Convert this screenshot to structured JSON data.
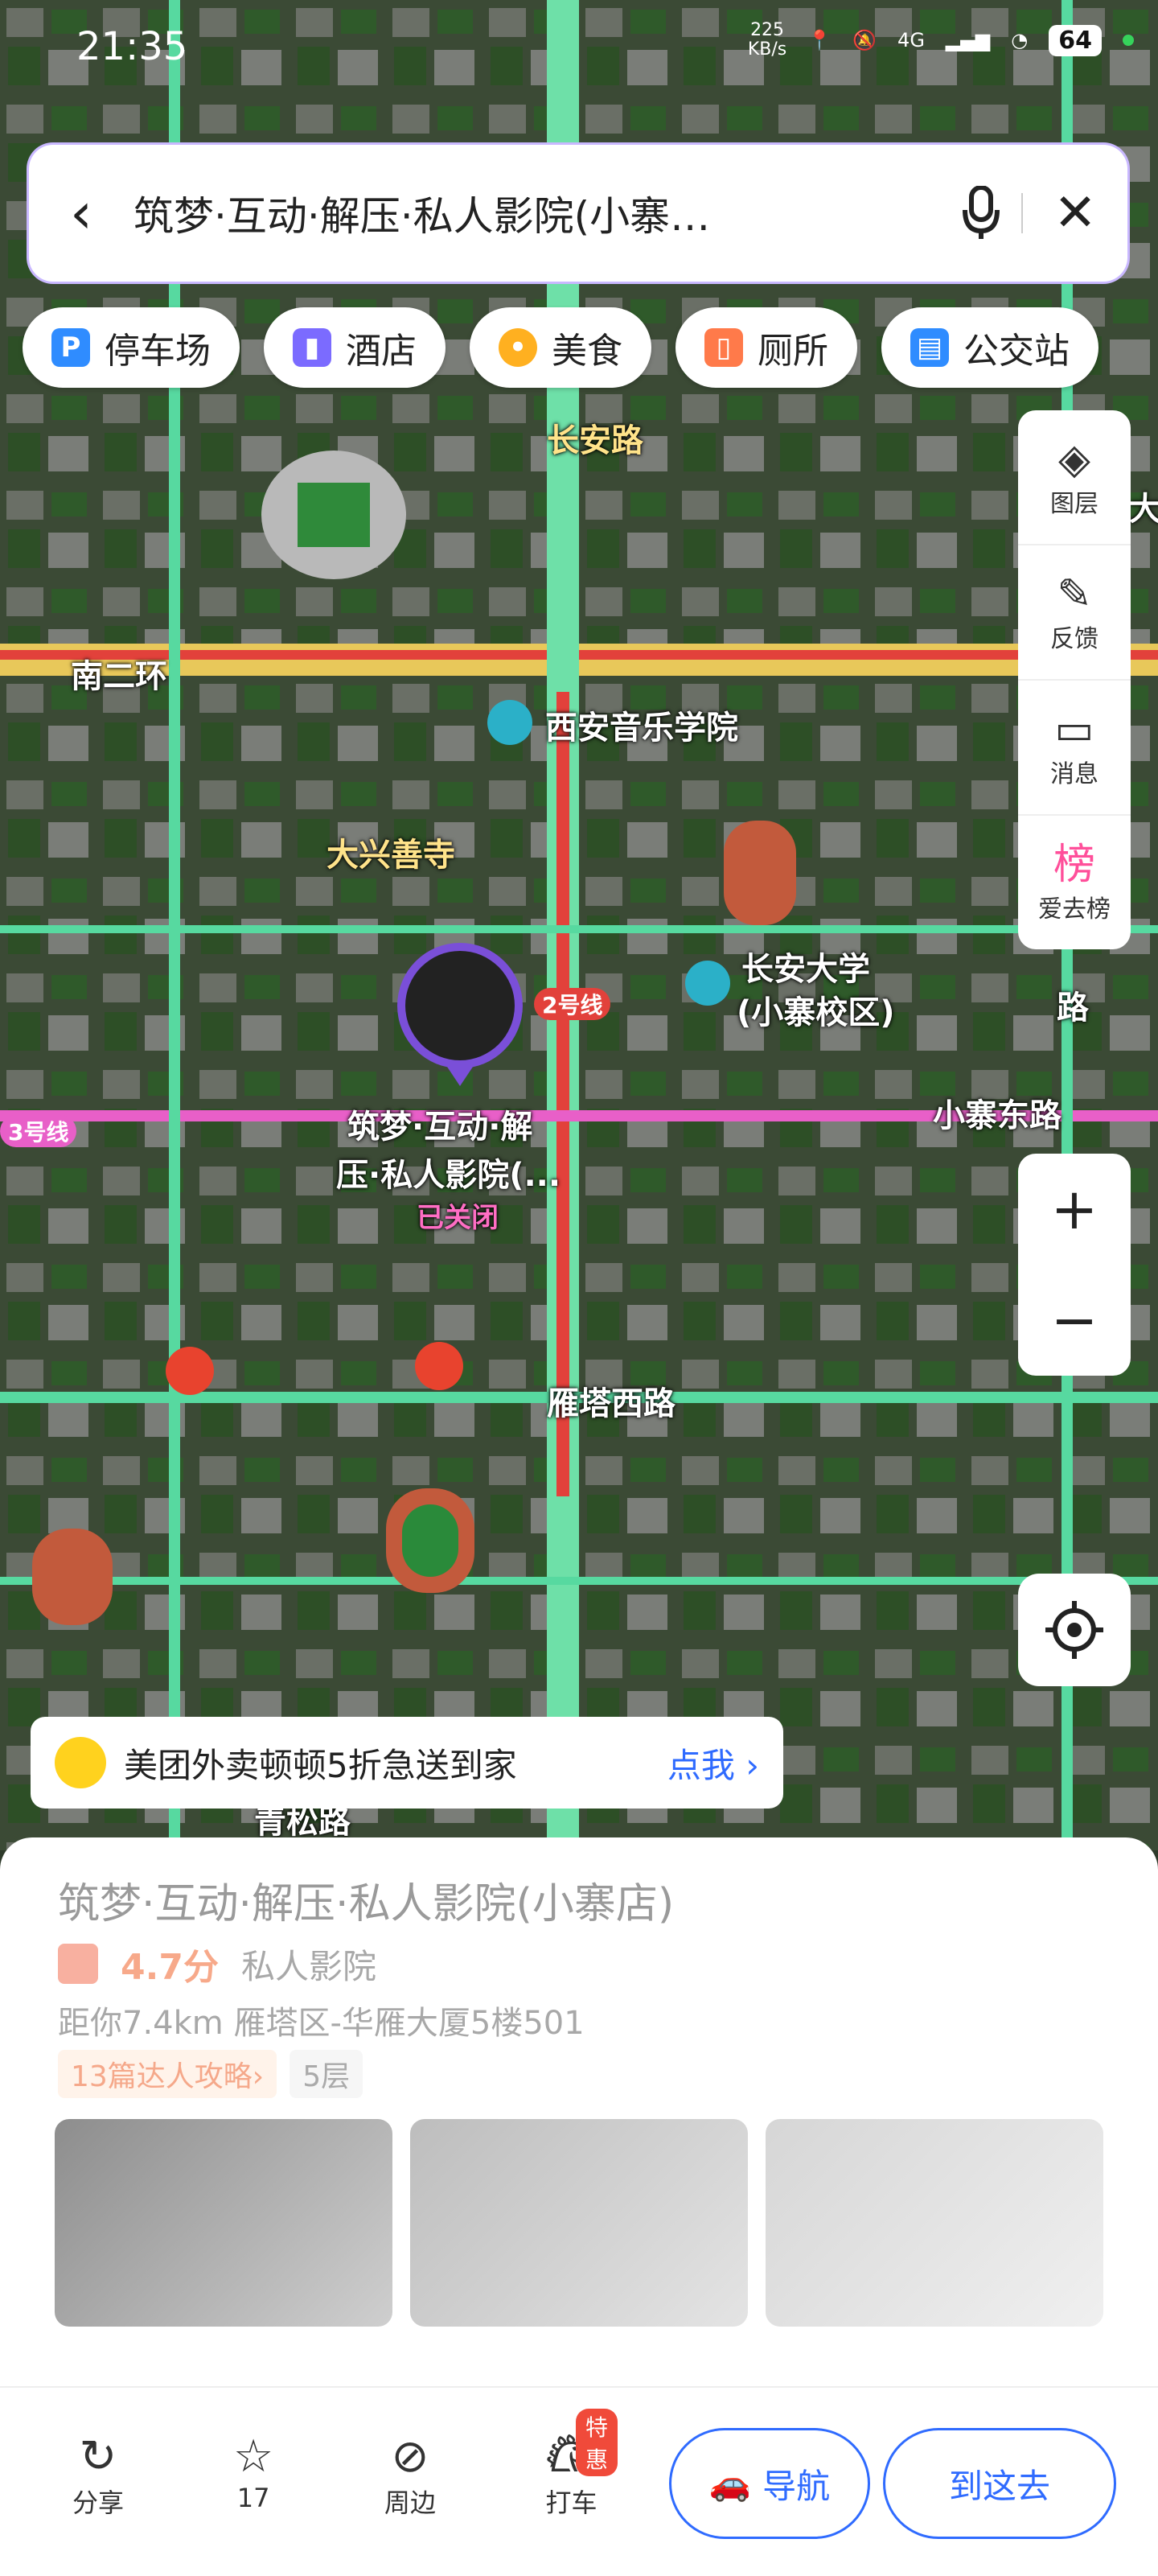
{
  "status": {
    "time": "21:35",
    "speed_value": "225",
    "speed_unit": "KB/s",
    "network": "4G",
    "battery": "64"
  },
  "search": {
    "query": "筑梦·互动·解压·私人影院(小寨…"
  },
  "categories": [
    {
      "label": "停车场",
      "icon": "parking-icon",
      "color": "#2f8cff"
    },
    {
      "label": "酒店",
      "icon": "hotel-icon",
      "color": "#7b6bff"
    },
    {
      "label": "美食",
      "icon": "food-icon",
      "color": "#ffb020"
    },
    {
      "label": "厕所",
      "icon": "toilet-icon",
      "color": "#ff7a4a"
    },
    {
      "label": "公交站",
      "icon": "bus-stop-icon",
      "color": "#2f8cff"
    }
  ],
  "tools": [
    {
      "label": "图层",
      "icon": "layers-icon"
    },
    {
      "label": "反馈",
      "icon": "feedback-icon"
    },
    {
      "label": "消息",
      "icon": "message-icon"
    },
    {
      "label": "爱去榜",
      "icon": "ranking-icon"
    }
  ],
  "map_labels": {
    "road_changan": "长安路",
    "ring": "南二环",
    "music_college": "西安音乐学院",
    "temple": "大兴善寺",
    "university": "长安大学",
    "university_sub": "(小寨校区)",
    "metro2": "2号线",
    "metro3": "3号线",
    "xiaozhai_east": "小寨东路",
    "yanta_west": "雁塔西路",
    "poi_name_1": "筑梦·互动·解",
    "poi_name_2": "压·私人影院(...",
    "poi_status": "已关闭",
    "edge_road": "路",
    "edge_char": "大",
    "partial_bottom": "青松路"
  },
  "promo": {
    "text": "美团外卖顿顿5折急送到家",
    "cta": "点我"
  },
  "place": {
    "name": "筑梦·互动·解压·私人影院(小寨店)",
    "score": "4.7分",
    "category": "私人影院",
    "address": "距你7.4km  雁塔区-华雁大厦5楼501",
    "tag_guides": "13篇达人攻略›",
    "tag_floor": "5层"
  },
  "actions": {
    "share": "分享",
    "favorite_count": "17",
    "nearby": "周边",
    "taxi": "打车",
    "taxi_badge": "特惠",
    "navigate": "导航",
    "go_here": "到这去"
  }
}
